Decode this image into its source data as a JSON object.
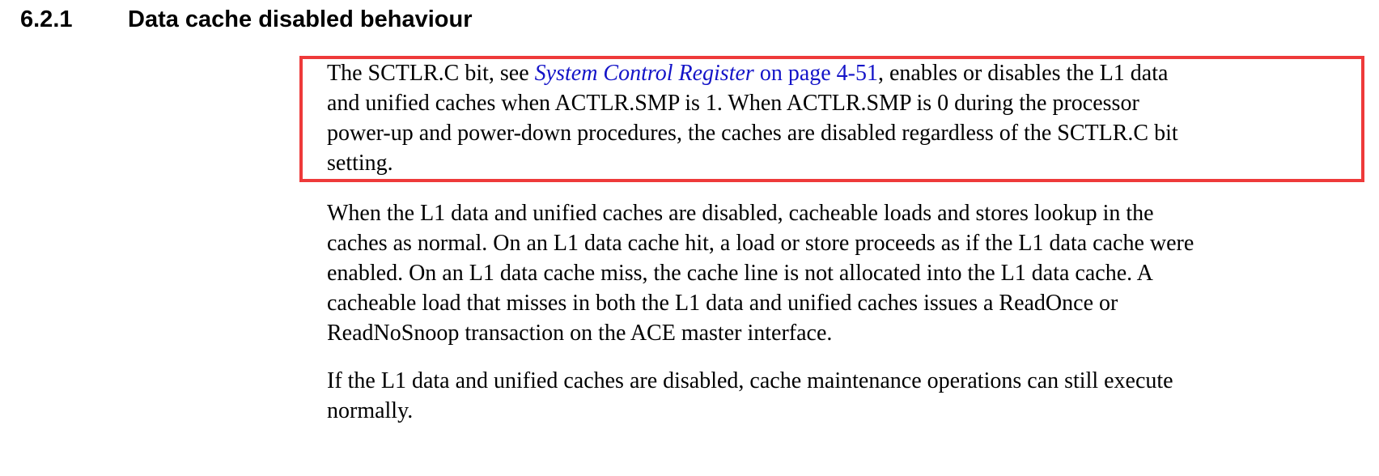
{
  "heading": {
    "number": "6.2.1",
    "title": "Data cache disabled behaviour"
  },
  "paragraph1": {
    "lines": [
      {
        "pre": "The SCTLR.C bit, see ",
        "link_italic": "System Control Register",
        "link_plain": " on page 4-51",
        "post": ", enables or disables the L1 data"
      },
      "and unified caches when ACTLR.SMP is 1.  When ACTLR.SMP is 0 during the processor",
      "power-up and power-down procedures, the caches are disabled regardless of the SCTLR.C bit",
      "setting."
    ]
  },
  "paragraph2": {
    "lines": [
      "When the L1 data and unified caches are disabled, cacheable loads and stores lookup in the",
      "caches as normal. On an L1 data cache hit, a load or store proceeds as if the L1 data cache were",
      "enabled.  On an L1 data cache miss, the cache line is not allocated into the L1 data cache.  A",
      "cacheable load that misses in both the L1 data and unified caches issues a ReadOnce or",
      "ReadNoSnoop transaction on the ACE master interface."
    ]
  },
  "paragraph3": {
    "lines": [
      "If the L1 data and unified caches are disabled, cache maintenance operations can still execute",
      "normally."
    ]
  },
  "colors": {
    "highlight_border": "#ee3a3a",
    "link": "#1414c8"
  }
}
